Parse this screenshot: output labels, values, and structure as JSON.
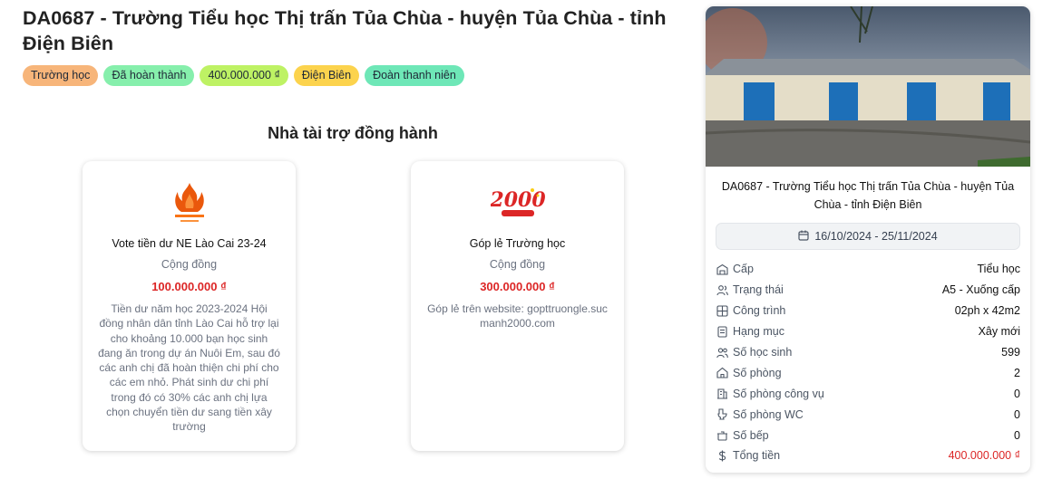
{
  "project": {
    "title": "DA0687 - Trường Tiểu học Thị trấn Tủa Chùa - huyện Tủa Chùa - tỉnh Điện Biên"
  },
  "tags": [
    {
      "label": "Trường học",
      "color": "#f7b57a"
    },
    {
      "label": "Đã hoàn thành",
      "color": "#86efac"
    },
    {
      "label": "400.000.000 ₫",
      "color": "#bef264"
    },
    {
      "label": "Điện Biên",
      "color": "#fcd34d"
    },
    {
      "label": "Đoàn thanh niên",
      "color": "#6ee7b7"
    }
  ],
  "sponsors_heading": "Nhà tài trợ đồng hành",
  "sponsors": [
    {
      "name": "Vote tiền dư NE Lào Cai 23-24",
      "type": "Cộng đồng",
      "amount": "100.000.000 ₫",
      "description": "Tiền dư năm học 2023-2024 Hội đồng nhân dân tỉnh Lào Cai hỗ trợ lại cho khoảng 10.000 bạn học sinh đang ăn trong dự án Nuôi Em, sau đó các anh chị đã hoàn thiện chi phí cho các em nhỏ. Phát sinh dư chi phí trong đó có 30% các anh chị lựa chọn chuyển tiền dư sang tiền xây trường",
      "logo_icon": "flame-logo-icon"
    },
    {
      "name": "Góp lẻ Trường học",
      "type": "Cộng đồng",
      "amount": "300.000.000 ₫",
      "description": "Góp lẻ trên website: gopttruongle.sucmanh2000.com",
      "logo_icon": "2000-logo-icon"
    }
  ],
  "side": {
    "title": "DA0687 - Trường Tiểu học Thị trấn Tủa Chùa - huyện Tủa Chùa - tỉnh Điện Biên",
    "date_range": "16/10/2024 - 25/11/2024",
    "details": [
      {
        "icon": "building-icon",
        "label": "Cấp",
        "value": "Tiểu học"
      },
      {
        "icon": "users-icon",
        "label": "Trạng thái",
        "value": "A5 - Xuống cấp"
      },
      {
        "icon": "grid-icon",
        "label": "Công trình",
        "value": "02ph x 42m2"
      },
      {
        "icon": "list-icon",
        "label": "Hạng mục",
        "value": "Xây mới"
      },
      {
        "icon": "students-icon",
        "label": "Số học sinh",
        "value": "599"
      },
      {
        "icon": "home-icon",
        "label": "Số phòng",
        "value": "2"
      },
      {
        "icon": "office-icon",
        "label": "Số phòng công vụ",
        "value": "0"
      },
      {
        "icon": "toilet-icon",
        "label": "Số phòng WC",
        "value": "0"
      },
      {
        "icon": "kitchen-icon",
        "label": "Số bếp",
        "value": "0"
      },
      {
        "icon": "dollar-icon",
        "label": "Tổng tiền",
        "value": "400.000.000 ₫",
        "highlight": true
      }
    ]
  }
}
